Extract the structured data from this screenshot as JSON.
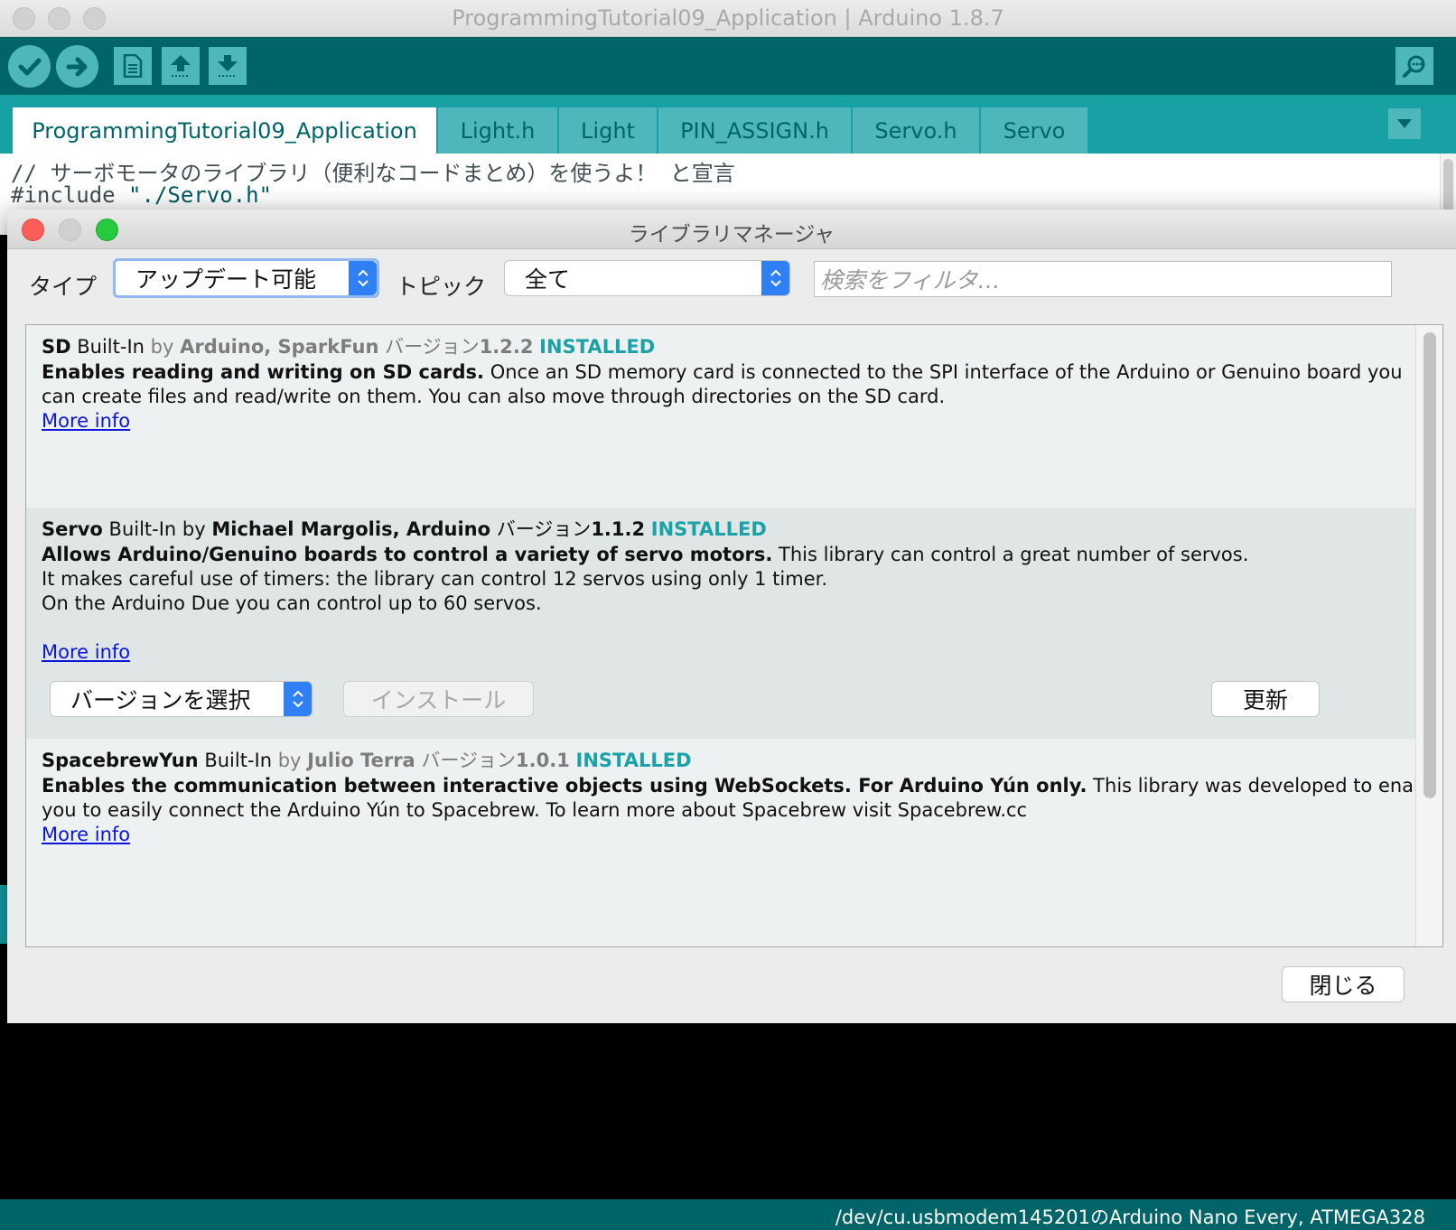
{
  "window": {
    "title": "ProgrammingTutorial09_Application | Arduino 1.8.7"
  },
  "toolbar": {
    "verify_icon": "check-icon",
    "upload_icon": "arrow-right-icon",
    "new_icon": "document-icon",
    "open_icon": "upload-arrow-icon",
    "save_icon": "download-arrow-icon",
    "serial_monitor_icon": "magnifier-icon"
  },
  "tabs": [
    {
      "label": "ProgrammingTutorial09_Application",
      "active": true
    },
    {
      "label": "Light.h"
    },
    {
      "label": "Light"
    },
    {
      "label": "PIN_ASSIGN.h"
    },
    {
      "label": "Servo.h"
    },
    {
      "label": "Servo"
    }
  ],
  "editor": {
    "line1": "// サーボモータのライブラリ（便利なコードまとめ）を使うよ！ と宣言",
    "line2_keyword": "#include ",
    "line2_string": "\"./Servo.h\""
  },
  "dialog": {
    "title": "ライブラリマネージャ",
    "type_label": "タイプ",
    "type_value": "アップデート可能",
    "topic_label": "トピック",
    "topic_value": "全て",
    "search_placeholder": "検索をフィルタ…",
    "close_button": "閉じる"
  },
  "libraries": [
    {
      "name": "SD",
      "builtin": "Built-In",
      "by": "by",
      "author": "Arduino, SparkFun",
      "version_label": "バージョン",
      "version": "1.2.2",
      "status": "INSTALLED",
      "summary": "Enables reading and writing on SD cards.",
      "desc1": " Once an SD memory card is connected to the SPI interface of the Arduino or Genuino board you",
      "desc2": "can create files and read/write on them. You can also move through directories on the SD card.",
      "more_info": "More info"
    },
    {
      "name": "Servo",
      "builtin": "Built-In",
      "by": "by",
      "author": "Michael Margolis, Arduino",
      "version_label": "バージョン",
      "version": "1.1.2",
      "status": "INSTALLED",
      "summary": "Allows Arduino/Genuino boards to control a variety of servo motors.",
      "desc1": " This library can control a great number of servos.",
      "desc2": "It makes careful use of timers: the library can control 12 servos using only 1 timer.",
      "desc3": "On the Arduino Due you can control up to 60 servos.",
      "more_info": "More info",
      "version_select": "バージョンを選択",
      "install_button": "インストール",
      "update_button": "更新"
    },
    {
      "name": "SpacebrewYun",
      "builtin": "Built-In",
      "by": "by",
      "author": "Julio Terra",
      "version_label": "バージョン",
      "version": "1.0.1",
      "status": "INSTALLED",
      "summary": "Enables the communication between interactive objects using WebSockets. For Arduino Yún only.",
      "desc1": " This library was developed to enable",
      "desc2": "you to easily connect the Arduino Yún to Spacebrew. To learn more about Spacebrew visit Spacebrew.cc",
      "more_info": "More info"
    }
  ],
  "status_bar": {
    "board": "/dev/cu.usbmodem145201のArduino Nano Every, ATMEGA328"
  },
  "colors": {
    "arduino_dark_teal": "#006468",
    "arduino_teal": "#17a1a5",
    "installed": "#1ba2a6",
    "link": "#0a16d8",
    "stepper_blue": "#2f7ff5"
  }
}
